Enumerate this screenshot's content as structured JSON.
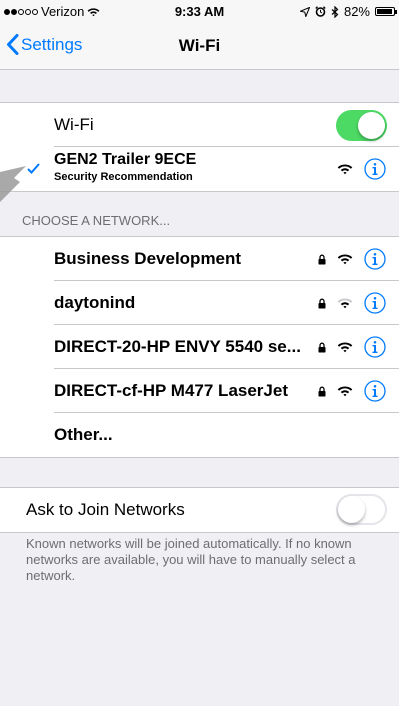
{
  "status_bar": {
    "carrier": "Verizon",
    "time": "9:33 AM",
    "battery_percent": "82%",
    "battery_level": 0.82,
    "icons": [
      "signal-dots-icon",
      "wifi-icon",
      "location-icon",
      "alarm-icon",
      "bluetooth-icon",
      "battery-icon"
    ]
  },
  "nav": {
    "back_label": "Settings",
    "title": "Wi-Fi"
  },
  "wifi_toggle": {
    "label": "Wi-Fi",
    "on": true
  },
  "connected": {
    "name": "GEN2 Trailer 9ECE",
    "subtitle": "Security Recommendation"
  },
  "networks_header": "CHOOSE A NETWORK...",
  "networks": [
    {
      "name": "Business Development",
      "secured": true
    },
    {
      "name": "daytonind",
      "secured": true
    },
    {
      "name": "DIRECT-20-HP ENVY 5540 se...",
      "secured": true
    },
    {
      "name": "DIRECT-cf-HP M477 LaserJet",
      "secured": true
    }
  ],
  "other_label": "Other...",
  "ask_to_join": {
    "label": "Ask to Join Networks",
    "on": false
  },
  "footer_text": "Known networks will be joined automatically. If no known networks are available, you will have to manually select a network.",
  "colors": {
    "accent": "#007aff",
    "toggle_on": "#4cd964",
    "background": "#efeff4"
  }
}
